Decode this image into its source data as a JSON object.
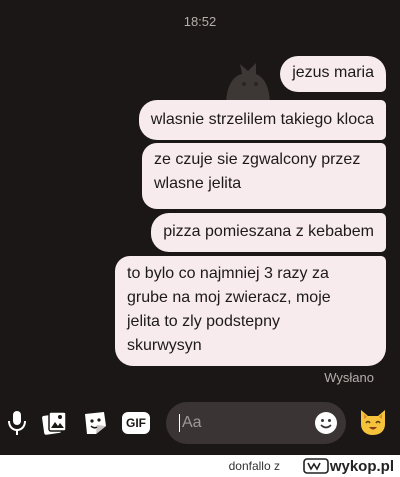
{
  "header": {
    "time": "18:52"
  },
  "messages": [
    {
      "text": "jezus maria"
    },
    {
      "text": "wlasnie strzelilem takiego kloca"
    },
    {
      "text": "ze czuje sie zgwalcony przez\nwlasne jelita"
    },
    {
      "text": "pizza pomieszana z kebabem"
    },
    {
      "text": "to bylo co najmniej 3 razy za\ngrube na moj zwieracz, moje\njelita to zly podstepny\nskurwysyn"
    }
  ],
  "status": "Wysłano",
  "composer": {
    "placeholder": "Aa",
    "icons": [
      "microphone-icon",
      "gallery-icon",
      "sticker-icon",
      "gif-icon",
      "emoji-icon",
      "cat-emoji-icon"
    ],
    "gif_label": "GIF"
  },
  "footer": {
    "author": "donfallo",
    "separator": "z",
    "brand": "wykop.pl"
  },
  "colors": {
    "background": "#1b1716",
    "bubble": "#f7ebee",
    "input": "#3a3534",
    "icons": "#ffffff",
    "cat": "#f5c33b"
  }
}
